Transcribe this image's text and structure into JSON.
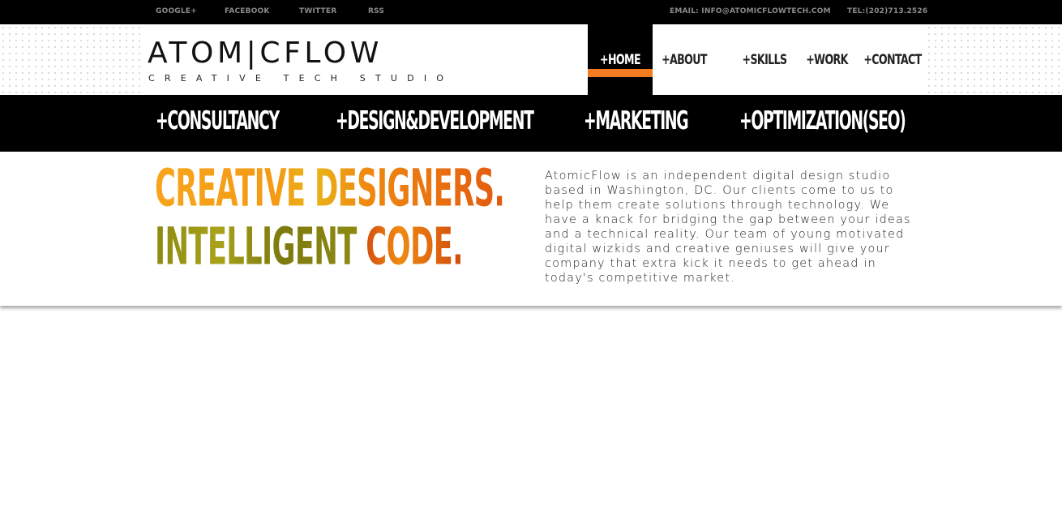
{
  "topbar": {
    "links": [
      "GOOGLE+",
      "FACEBOOK",
      "TWITTER",
      "RSS"
    ],
    "email": "EMAIL: INFO@ATOMICFLOWTECH.COM",
    "phone": "TEL:(202)713.2526"
  },
  "logo": {
    "name": "ATOM|CFLOW",
    "tagline": "CREATIVE TECH STUDIO"
  },
  "nav": {
    "items": [
      "+HOME",
      "+ABOUT",
      "+SKILLS",
      "+WORK",
      "+CONTACT"
    ],
    "active": "+HOME"
  },
  "services": [
    "+CONSULTANCY",
    "+DESIGN&DEVELOPMENT",
    "+MARKETING",
    "+OPTIMIZATION(SEO)"
  ],
  "hero": {
    "line1": "CREATIVE DESIGNERS.",
    "line2_a": "INTELLIGENT ",
    "line2_b": "CODE.",
    "description": "AtomicFlow is an independent digital design studio based in Washington, DC. Our clients come to us to help them create solutions through technology. We have a knack for bridging the gap between your ideas and a technical reality. Our team of young motivated digital wizkids and creative geniuses will give your company that extra kick it needs to get ahead in today's competitive market."
  },
  "colors": {
    "accent": "#f47c20",
    "olive": "#8c8a12",
    "bar": "#000000"
  }
}
